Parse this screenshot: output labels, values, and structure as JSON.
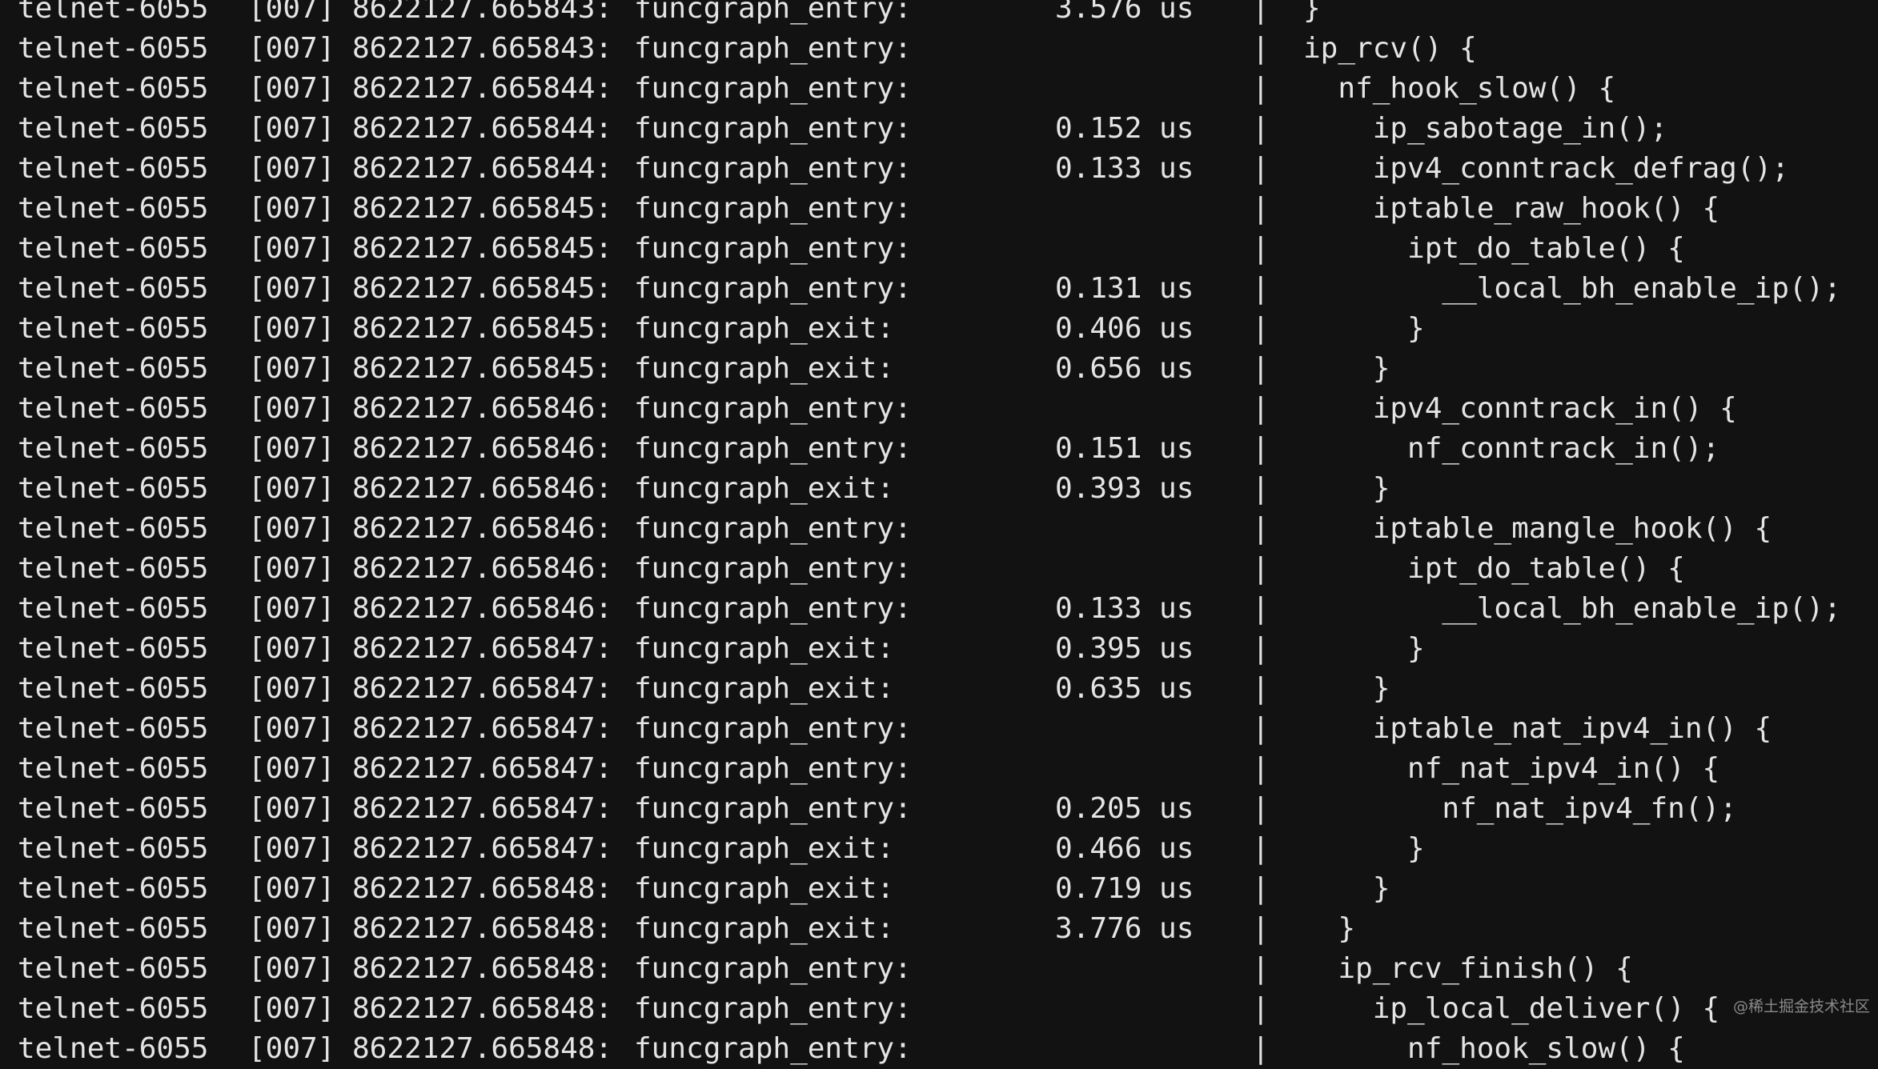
{
  "terminal": {
    "lines": [
      {
        "task": "telnet-6055",
        "cpu": "[007]",
        "ts": "8622127.665843:",
        "event": "funcgraph_entry:",
        "dur": "3.576 us",
        "sep": "|",
        "func": "}"
      },
      {
        "task": "telnet-6055",
        "cpu": "[007]",
        "ts": "8622127.665843:",
        "event": "funcgraph_entry:",
        "dur": "",
        "sep": "|",
        "func": "ip_rcv() {"
      },
      {
        "task": "telnet-6055",
        "cpu": "[007]",
        "ts": "8622127.665844:",
        "event": "funcgraph_entry:",
        "dur": "",
        "sep": "|",
        "func": "  nf_hook_slow() {"
      },
      {
        "task": "telnet-6055",
        "cpu": "[007]",
        "ts": "8622127.665844:",
        "event": "funcgraph_entry:",
        "dur": "0.152 us",
        "sep": "|",
        "func": "    ip_sabotage_in();"
      },
      {
        "task": "telnet-6055",
        "cpu": "[007]",
        "ts": "8622127.665844:",
        "event": "funcgraph_entry:",
        "dur": "0.133 us",
        "sep": "|",
        "func": "    ipv4_conntrack_defrag();"
      },
      {
        "task": "telnet-6055",
        "cpu": "[007]",
        "ts": "8622127.665845:",
        "event": "funcgraph_entry:",
        "dur": "",
        "sep": "|",
        "func": "    iptable_raw_hook() {"
      },
      {
        "task": "telnet-6055",
        "cpu": "[007]",
        "ts": "8622127.665845:",
        "event": "funcgraph_entry:",
        "dur": "",
        "sep": "|",
        "func": "      ipt_do_table() {"
      },
      {
        "task": "telnet-6055",
        "cpu": "[007]",
        "ts": "8622127.665845:",
        "event": "funcgraph_entry:",
        "dur": "0.131 us",
        "sep": "|",
        "func": "        __local_bh_enable_ip();"
      },
      {
        "task": "telnet-6055",
        "cpu": "[007]",
        "ts": "8622127.665845:",
        "event": "funcgraph_exit:",
        "dur": "0.406 us",
        "sep": "|",
        "func": "      }"
      },
      {
        "task": "telnet-6055",
        "cpu": "[007]",
        "ts": "8622127.665845:",
        "event": "funcgraph_exit:",
        "dur": "0.656 us",
        "sep": "|",
        "func": "    }"
      },
      {
        "task": "telnet-6055",
        "cpu": "[007]",
        "ts": "8622127.665846:",
        "event": "funcgraph_entry:",
        "dur": "",
        "sep": "|",
        "func": "    ipv4_conntrack_in() {"
      },
      {
        "task": "telnet-6055",
        "cpu": "[007]",
        "ts": "8622127.665846:",
        "event": "funcgraph_entry:",
        "dur": "0.151 us",
        "sep": "|",
        "func": "      nf_conntrack_in();"
      },
      {
        "task": "telnet-6055",
        "cpu": "[007]",
        "ts": "8622127.665846:",
        "event": "funcgraph_exit:",
        "dur": "0.393 us",
        "sep": "|",
        "func": "    }"
      },
      {
        "task": "telnet-6055",
        "cpu": "[007]",
        "ts": "8622127.665846:",
        "event": "funcgraph_entry:",
        "dur": "",
        "sep": "|",
        "func": "    iptable_mangle_hook() {"
      },
      {
        "task": "telnet-6055",
        "cpu": "[007]",
        "ts": "8622127.665846:",
        "event": "funcgraph_entry:",
        "dur": "",
        "sep": "|",
        "func": "      ipt_do_table() {"
      },
      {
        "task": "telnet-6055",
        "cpu": "[007]",
        "ts": "8622127.665846:",
        "event": "funcgraph_entry:",
        "dur": "0.133 us",
        "sep": "|",
        "func": "        __local_bh_enable_ip();"
      },
      {
        "task": "telnet-6055",
        "cpu": "[007]",
        "ts": "8622127.665847:",
        "event": "funcgraph_exit:",
        "dur": "0.395 us",
        "sep": "|",
        "func": "      }"
      },
      {
        "task": "telnet-6055",
        "cpu": "[007]",
        "ts": "8622127.665847:",
        "event": "funcgraph_exit:",
        "dur": "0.635 us",
        "sep": "|",
        "func": "    }"
      },
      {
        "task": "telnet-6055",
        "cpu": "[007]",
        "ts": "8622127.665847:",
        "event": "funcgraph_entry:",
        "dur": "",
        "sep": "|",
        "func": "    iptable_nat_ipv4_in() {"
      },
      {
        "task": "telnet-6055",
        "cpu": "[007]",
        "ts": "8622127.665847:",
        "event": "funcgraph_entry:",
        "dur": "",
        "sep": "|",
        "func": "      nf_nat_ipv4_in() {"
      },
      {
        "task": "telnet-6055",
        "cpu": "[007]",
        "ts": "8622127.665847:",
        "event": "funcgraph_entry:",
        "dur": "0.205 us",
        "sep": "|",
        "func": "        nf_nat_ipv4_fn();"
      },
      {
        "task": "telnet-6055",
        "cpu": "[007]",
        "ts": "8622127.665847:",
        "event": "funcgraph_exit:",
        "dur": "0.466 us",
        "sep": "|",
        "func": "      }"
      },
      {
        "task": "telnet-6055",
        "cpu": "[007]",
        "ts": "8622127.665848:",
        "event": "funcgraph_exit:",
        "dur": "0.719 us",
        "sep": "|",
        "func": "    }"
      },
      {
        "task": "telnet-6055",
        "cpu": "[007]",
        "ts": "8622127.665848:",
        "event": "funcgraph_exit:",
        "dur": "3.776 us",
        "sep": "|",
        "func": "  }"
      },
      {
        "task": "telnet-6055",
        "cpu": "[007]",
        "ts": "8622127.665848:",
        "event": "funcgraph_entry:",
        "dur": "",
        "sep": "|",
        "func": "  ip_rcv_finish() {"
      },
      {
        "task": "telnet-6055",
        "cpu": "[007]",
        "ts": "8622127.665848:",
        "event": "funcgraph_entry:",
        "dur": "",
        "sep": "|",
        "func": "    ip_local_deliver() {"
      },
      {
        "task": "telnet-6055",
        "cpu": "[007]",
        "ts": "8622127.665848:",
        "event": "funcgraph_entry:",
        "dur": "",
        "sep": "|",
        "func": "      nf_hook_slow() {"
      }
    ]
  },
  "watermark": "@稀土掘金技术社区",
  "colors": {
    "background": "#121212",
    "text": "#e4e4e4",
    "watermark": "#8a8a8a"
  }
}
